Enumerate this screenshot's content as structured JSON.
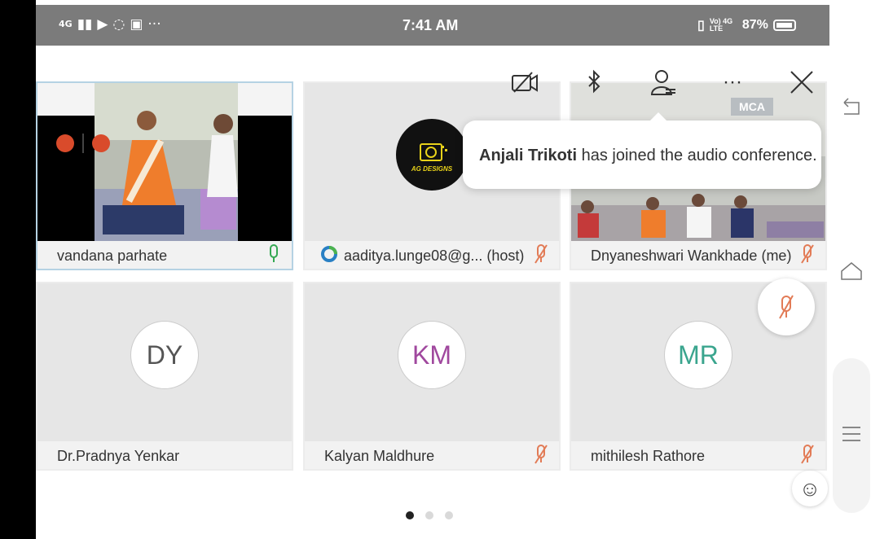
{
  "status_bar": {
    "network": "4G",
    "time": "7:41 AM",
    "right_text": "Vo) 4G LTE",
    "battery": "87%"
  },
  "toolbar": {
    "camera_off_icon": "video-off-icon",
    "bluetooth_icon": "bluetooth-icon",
    "participants_icon": "participants-icon",
    "more_icon": "more-icon",
    "close_icon": "close-icon"
  },
  "toast": {
    "name": "Anjali Trikoti",
    "message": " has joined the audio conference."
  },
  "tiles": [
    {
      "name": "vandana parhate",
      "mic": "on"
    },
    {
      "name": "aaditya.lunge08@g... (host)",
      "mic": "muted",
      "avatar_logo": "AG DESIGNS"
    },
    {
      "name": "Dnyaneshwari Wankhade (me)",
      "mic": "muted",
      "sign": "MCA"
    },
    {
      "name": "Dr.Pradnya Yenkar",
      "initials": "DY",
      "initials_color": "#555555"
    },
    {
      "name": "Kalyan Maldhure",
      "initials": "KM",
      "initials_color": "#a0489e",
      "mic": "muted"
    },
    {
      "name": "mithilesh Rathore",
      "initials": "MR",
      "initials_color": "#3aa58e",
      "mic": "muted"
    }
  ],
  "pagination": {
    "pages": 3,
    "current": 1
  },
  "colors": {
    "muted_mic": "#e27b56",
    "active_mic": "#35a853",
    "status_bar": "#7b7b7b"
  }
}
